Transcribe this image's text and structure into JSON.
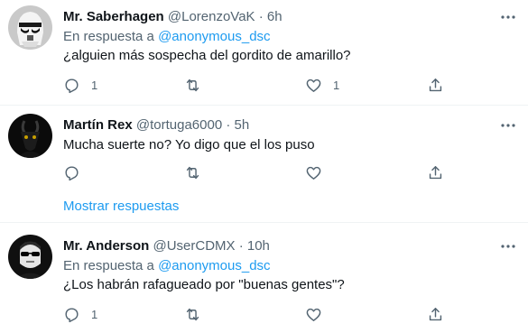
{
  "tweets": [
    {
      "name": "Mr. Saberhagen",
      "handle": "@LorenzoVaK",
      "time": "6h",
      "reply_prefix": "En respuesta a",
      "reply_mention": "@anonymous_dsc",
      "text": "¿alguien más sospecha del gordito de amarillo?",
      "reply_count": "1",
      "retweet_count": "",
      "like_count": "1"
    },
    {
      "name": "Martín Rex",
      "handle": "@tortuga6000",
      "time": "5h",
      "text": "Mucha suerte no? Yo digo que el los puso",
      "reply_count": "",
      "retweet_count": "",
      "like_count": ""
    },
    {
      "name": "Mr. Anderson",
      "handle": "@UserCDMX",
      "time": "10h",
      "reply_prefix": "En respuesta a",
      "reply_mention": "@anonymous_dsc",
      "text": "¿Los habrán rafagueado por \"buenas gentes\"?",
      "reply_count": "1",
      "retweet_count": "",
      "like_count": ""
    }
  ],
  "show_replies": "Mostrar respuestas",
  "separator_dot": "·",
  "colors": {
    "accent": "#1d9bf0",
    "secondary_text": "#536471",
    "primary_text": "#0f1419",
    "divider": "#eff3f4"
  },
  "icons": [
    "more-icon",
    "reply-icon",
    "retweet-icon",
    "like-icon",
    "share-icon"
  ]
}
